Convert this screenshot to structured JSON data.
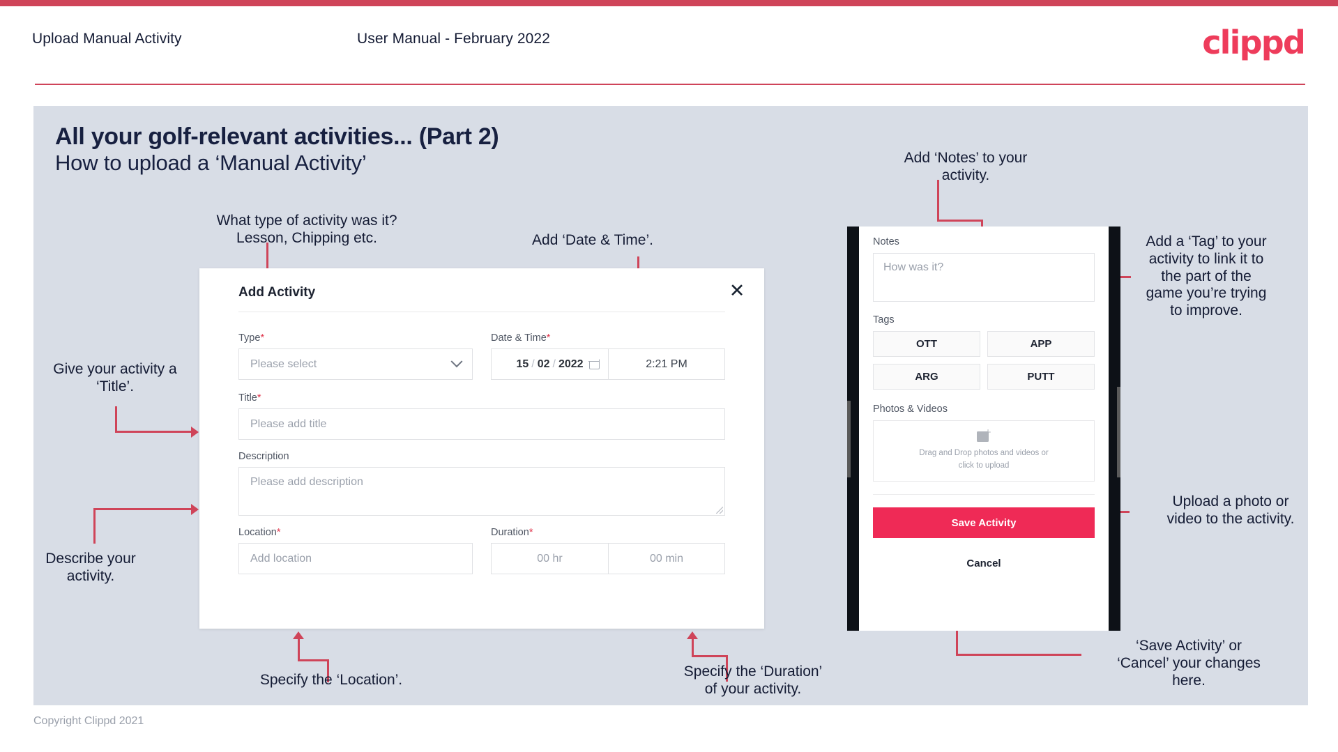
{
  "header": {
    "title": "Upload Manual Activity",
    "subtitle": "User Manual - February 2022",
    "brand": "clippd",
    "brand_color": "#ee3c5b"
  },
  "slide": {
    "title": "All your golf-relevant activities... (Part 2)",
    "subtitle": "How to upload a ‘Manual Activity’",
    "background_color": "#d8dde6"
  },
  "annotations": {
    "type": "What type of activity was it?\nLesson, Chipping etc.",
    "datetime": "Add ‘Date & Time’.",
    "title": "Give your activity a\n‘Title’.",
    "description": "Describe your\nactivity.",
    "location": "Specify the ‘Location’.",
    "duration": "Specify the ‘Duration’\nof your activity.",
    "notes": "Add ‘Notes’ to your\nactivity.",
    "tags": "Add a ‘Tag’ to your\nactivity to link it to\nthe part of the\ngame you’re trying\nto improve.",
    "upload": "Upload a photo or\nvideo to the activity.",
    "save_cancel": "‘Save Activity’ or\n‘Cancel’ your changes\nhere."
  },
  "dialog": {
    "title": "Add Activity",
    "close_icon": "close-icon",
    "fields": {
      "type": {
        "label": "Type",
        "required": "*",
        "placeholder": "Please select",
        "icon": "chevron-down-icon"
      },
      "datetime": {
        "label": "Date & Time",
        "required": "*",
        "day": "15",
        "month": "02",
        "year": "2022",
        "separator": "/",
        "calendar_icon": "calendar-icon",
        "time": "2:21 PM"
      },
      "title": {
        "label": "Title",
        "required": "*",
        "placeholder": "Please add title"
      },
      "description": {
        "label": "Description",
        "required": "",
        "placeholder": "Please add description"
      },
      "location": {
        "label": "Location",
        "required": "*",
        "placeholder": "Add location"
      },
      "duration": {
        "label": "Duration",
        "required": "*",
        "hours_placeholder": "00 hr",
        "minutes_placeholder": "00 min"
      }
    }
  },
  "phone": {
    "notes": {
      "label": "Notes",
      "placeholder": "How was it?"
    },
    "tags": {
      "label": "Tags",
      "items": [
        "OTT",
        "APP",
        "ARG",
        "PUTT"
      ]
    },
    "photos": {
      "label": "Photos & Videos",
      "icon": "add-image-icon",
      "drop_text_line1": "Drag and Drop photos and videos or",
      "drop_text_line2": "click to upload"
    },
    "save_label": "Save Activity",
    "save_color": "#ef2a56",
    "cancel_label": "Cancel"
  },
  "footer": {
    "copyright": "Copyright Clippd 2021"
  }
}
